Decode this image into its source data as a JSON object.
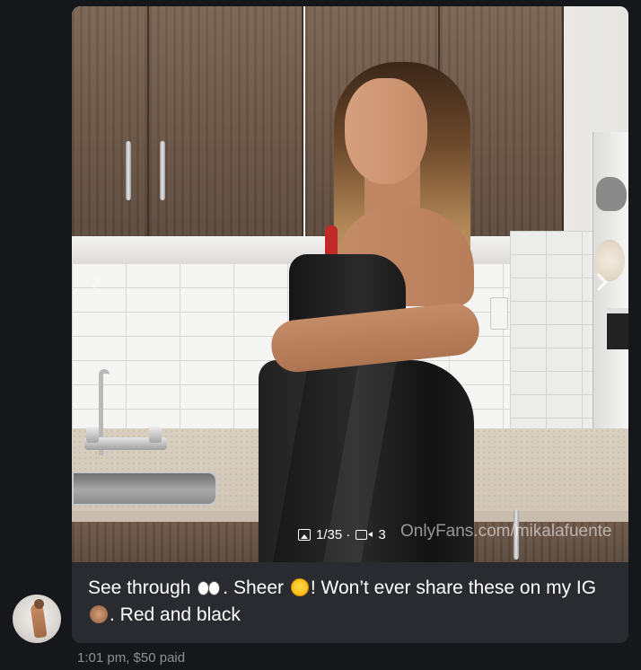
{
  "message": {
    "caption_part1": "See through",
    "caption_part2": ". Sheer",
    "caption_part3": "! Won’t ever share these on my IG",
    "caption_part4": ". Red and black",
    "emoji_1": "eyes-emoji",
    "emoji_2": "flushed-face-emoji",
    "emoji_3": "see-no-evil-monkey-emoji",
    "meta": "1:01 pm,  $50 paid"
  },
  "media": {
    "counter_text": "1/35 · ",
    "video_count": "3",
    "watermark": "OnlyFans.com/mikalafuente"
  },
  "icons": {
    "image": "image-icon",
    "video": "video-icon",
    "next": "chevron-right-icon",
    "prev": "chevron-left-icon"
  },
  "colors": {
    "background": "#16171b",
    "bubble": "#2a2b30",
    "meta_text": "#8d8f95"
  }
}
